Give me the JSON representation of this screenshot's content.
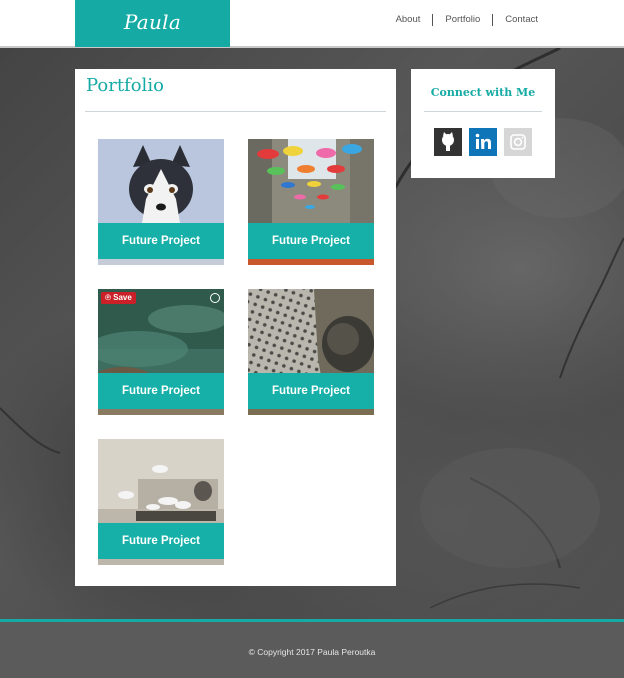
{
  "brand": {
    "name": "Paula Peroutka",
    "accent_color": "#16aaa4"
  },
  "nav": {
    "items": [
      "About",
      "Portfolio",
      "Contact"
    ]
  },
  "portfolio": {
    "title": "Portfolio",
    "projects": [
      {
        "label": "Future Project",
        "image": "husky-dog"
      },
      {
        "label": "Future Project",
        "image": "umbrella-street"
      },
      {
        "label": "Future Project",
        "image": "rocky-water",
        "save_label": "Save"
      },
      {
        "label": "Future Project",
        "image": "perforated-metal-wall"
      },
      {
        "label": "Future Project",
        "image": "white-birds-fountain"
      }
    ]
  },
  "connect": {
    "title": "Connect with Me",
    "links": [
      {
        "icon": "github-icon",
        "color": "#333333"
      },
      {
        "icon": "linkedin-icon",
        "color": "#0e76b8"
      },
      {
        "icon": "instagram-icon",
        "color": "#d6d6d6"
      }
    ]
  },
  "footer": {
    "copyright": "© Copyright 2017 Paula Peroutka"
  }
}
